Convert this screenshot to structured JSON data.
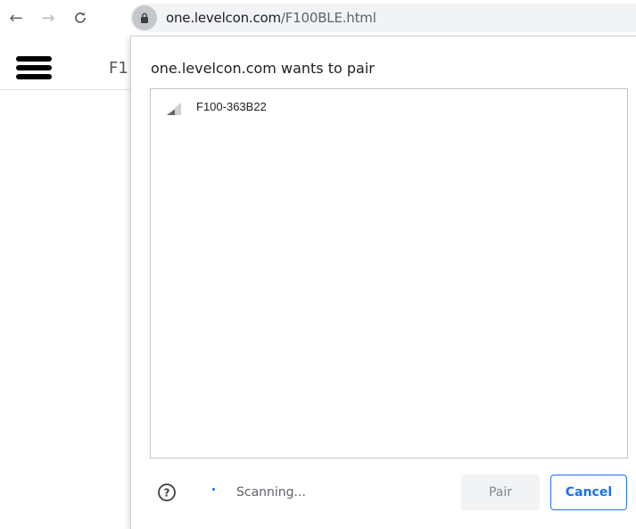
{
  "browser": {
    "url_host": "one.levelcon.com",
    "url_path": "/F100BLE.html",
    "icons": {
      "back": "arrow-left-icon",
      "forward": "arrow-right-icon",
      "reload": "reload-icon",
      "lock": "lock-icon"
    }
  },
  "page": {
    "title_fragment": "F1"
  },
  "chooser": {
    "title": "one.levelcon.com wants to pair",
    "devices": [
      {
        "name": "F100-363B22",
        "signal_level": 0.5
      }
    ],
    "status": "Scanning...",
    "pair_label": "Pair",
    "cancel_label": "Cancel"
  },
  "colors": {
    "accent": "#1a73e8",
    "muted": "#5f6368"
  }
}
